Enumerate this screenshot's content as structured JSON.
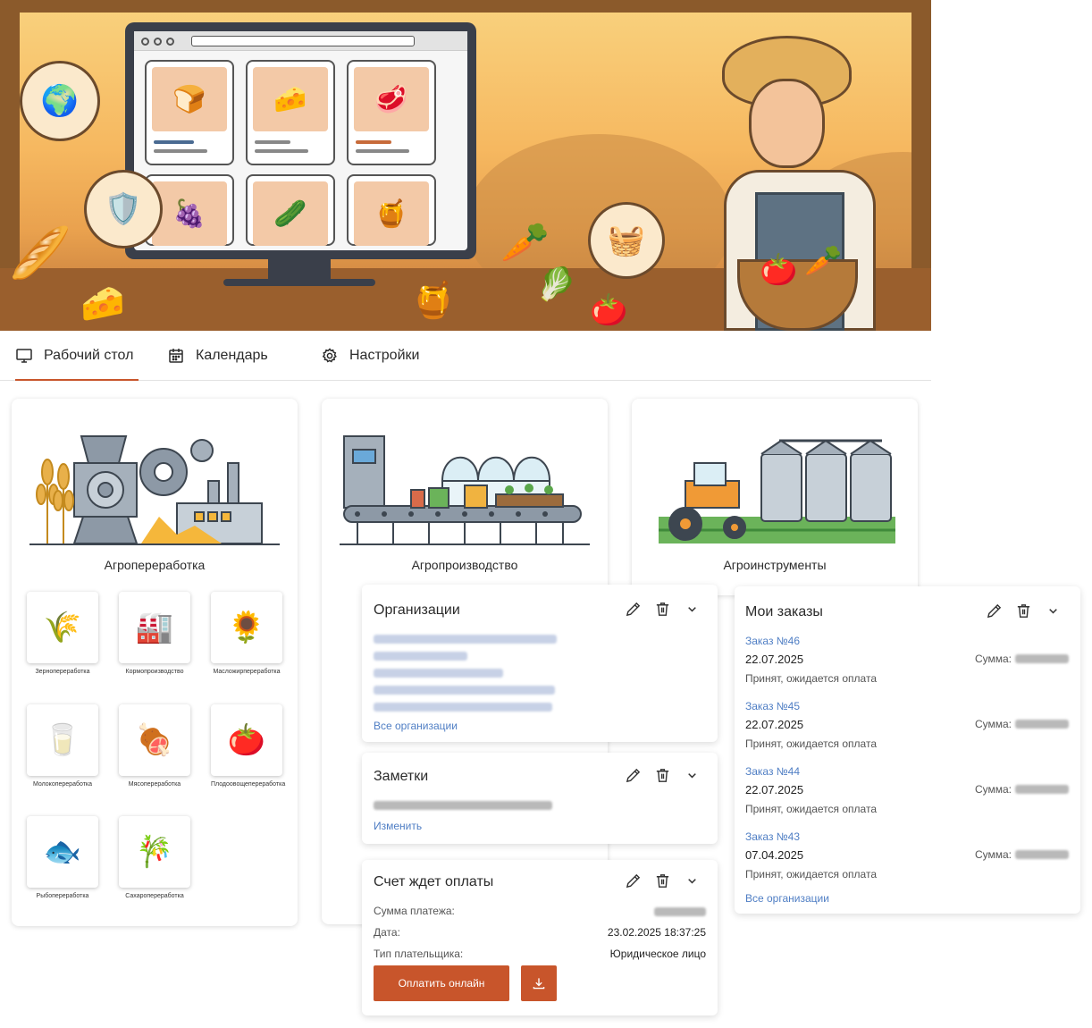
{
  "tabs": [
    {
      "label": "Рабочий стол",
      "active": true
    },
    {
      "label": "Календарь",
      "active": false
    },
    {
      "label": "Настройки",
      "active": false
    }
  ],
  "categories": [
    {
      "title": "Агропереработка",
      "items": [
        {
          "label": "Зернопереработка",
          "icon": "grain-processing-icon"
        },
        {
          "label": "Кормопроизводство",
          "icon": "feed-production-icon"
        },
        {
          "label": "Масложирпереработка",
          "icon": "oil-processing-icon"
        },
        {
          "label": "Молокопереработка",
          "icon": "milk-processing-icon"
        },
        {
          "label": "Мясопереработка",
          "icon": "meat-processing-icon"
        },
        {
          "label": "Плодоовощепереработка",
          "icon": "fruit-veg-processing-icon"
        },
        {
          "label": "Рыбопереработка",
          "icon": "fish-processing-icon"
        },
        {
          "label": "Сахаропереработка",
          "icon": "sugar-processing-icon"
        }
      ]
    },
    {
      "title": "Агропроизводство"
    },
    {
      "title": "Агроинструменты"
    }
  ],
  "widgets": {
    "organizations": {
      "title": "Организации",
      "all_link": "Все организации"
    },
    "notes": {
      "title": "Заметки",
      "edit_link": "Изменить"
    },
    "invoice": {
      "title": "Счет ждет оплаты",
      "amount_label": "Сумма платежа:",
      "date_label": "Дата:",
      "date_value": "23.02.2025 18:37:25",
      "payer_label": "Тип плательщика:",
      "payer_value": "Юридическое лицо",
      "pay_button": "Оплатить онлайн"
    },
    "orders": {
      "title": "Мои заказы",
      "sum_label": "Сумма:",
      "items": [
        {
          "number": "Заказ №46",
          "date": "22.07.2025",
          "status": "Принят, ожидается оплата"
        },
        {
          "number": "Заказ №45",
          "date": "22.07.2025",
          "status": "Принят, ожидается оплата"
        },
        {
          "number": "Заказ №44",
          "date": "22.07.2025",
          "status": "Принят, ожидается оплата"
        },
        {
          "number": "Заказ №43",
          "date": "07.04.2025",
          "status": "Принят, ожидается оплата"
        }
      ],
      "all_link": "Все организации"
    }
  },
  "colors": {
    "accent": "#c8552b",
    "link": "#4f7ec4"
  }
}
